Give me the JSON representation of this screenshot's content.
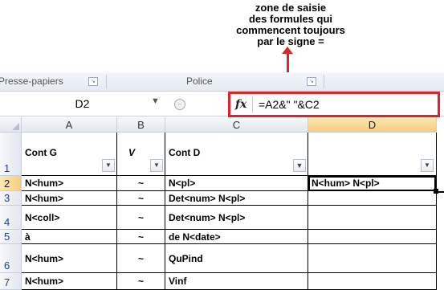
{
  "annotation": {
    "lines": [
      "zone  de saisie",
      "des formules qui",
      "commencent toujours",
      "par le signe ="
    ],
    "color": "#d9262c"
  },
  "ribbon": {
    "groups": [
      "Presse-papiers",
      "Police"
    ],
    "launcher_icon": "dialog-launcher-icon"
  },
  "formula_bar": {
    "name_box": "D2",
    "fx_label": "fx",
    "formula": "=A2&\" \"&C2"
  },
  "columns": [
    "A",
    "B",
    "C",
    "D"
  ],
  "selected_column": "D",
  "rows": [
    {
      "num": "1",
      "A": "Cont G",
      "B": "V",
      "C": "Cont D",
      "D": ""
    },
    {
      "num": "2",
      "A": "N<hum>",
      "B": "~",
      "C": "N<pl>",
      "D": "N<hum> N<pl>"
    },
    {
      "num": "3",
      "A": "N<hum>",
      "B": "~",
      "C": "Det<num> N<pl>",
      "D": ""
    },
    {
      "num": "4",
      "A": "N<coll>",
      "B": "~",
      "C": "Det<num> N<pl>",
      "D": ""
    },
    {
      "num": "5",
      "A": "à",
      "B": "~",
      "C": "de N<date>",
      "D": ""
    },
    {
      "num": "6",
      "A": "N<hum>",
      "B": "~",
      "C": "QuPind",
      "D": ""
    },
    {
      "num": "7",
      "A": "N<hum>",
      "B": "~",
      "C": "Vinf",
      "D": ""
    }
  ],
  "filters": {
    "A": "dropdown-icon",
    "B": "dropdown-icon",
    "C": "filter-active-icon",
    "D": "dropdown-icon"
  },
  "active_cell": "D2"
}
